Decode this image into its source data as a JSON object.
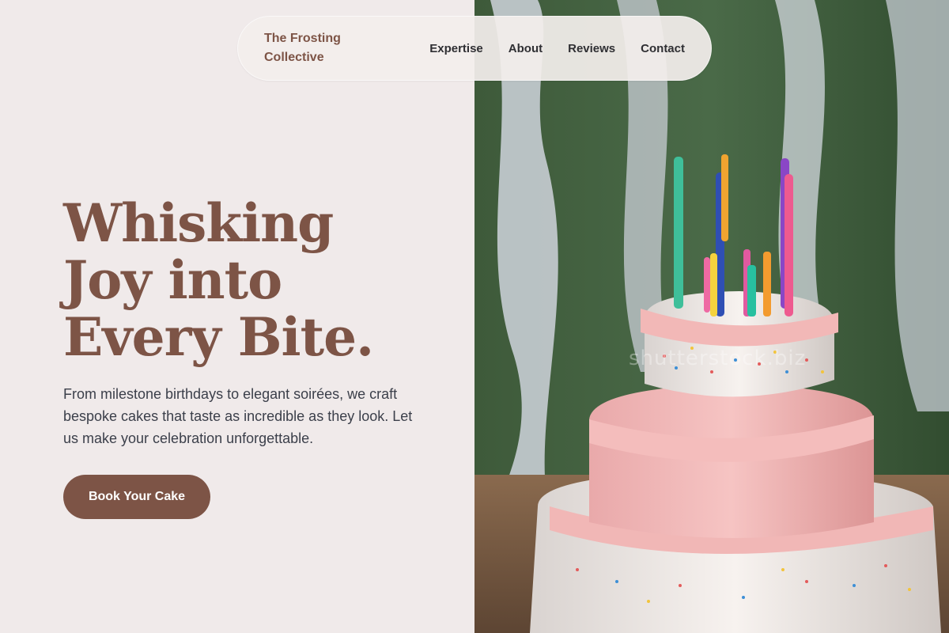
{
  "nav": {
    "brand": "The Frosting Collective",
    "links": [
      "Expertise",
      "About",
      "Reviews",
      "Contact"
    ]
  },
  "hero": {
    "title": "Whisking Joy into Every Bite.",
    "subtitle": "From milestone birthdays to elegant soirées, we craft bespoke cakes that taste as incredible as they look. Let us make your celebration unforgettable.",
    "cta_label": "Book Your Cake"
  },
  "image": {
    "subject": "birthday-cake-photo",
    "watermark_text": "shutterstock.biz"
  },
  "colors": {
    "accent": "#7d5446",
    "page_background": "#f0eaea",
    "body_text": "#3b3f4a",
    "nav_text": "#2f2f33"
  }
}
